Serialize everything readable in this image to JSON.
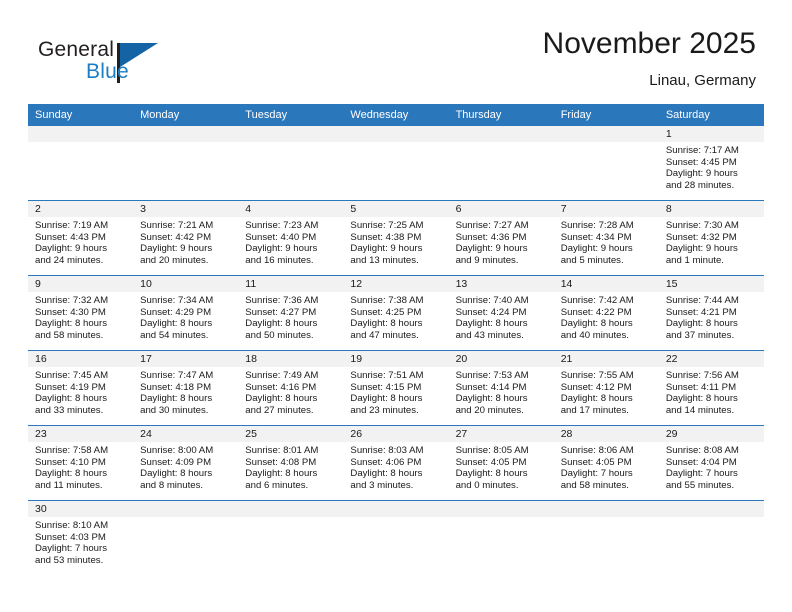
{
  "brand": {
    "name_top": "General",
    "name_bottom": "Blue",
    "accent_color": "#1464a5",
    "blue_text_color": "#1d7dc4"
  },
  "header": {
    "title": "November 2025",
    "subtitle": "Linau, Germany"
  },
  "theme": {
    "header_band": "#2b77bc",
    "daynum_strip": "#f2f2f2",
    "grid_line": "#2b77bc",
    "text": "#1a1a1a"
  },
  "calendar": {
    "weekday_headers": [
      "Sunday",
      "Monday",
      "Tuesday",
      "Wednesday",
      "Thursday",
      "Friday",
      "Saturday"
    ],
    "weeks": [
      [
        {
          "day": "",
          "sunrise": "",
          "sunset": "",
          "daylight": "",
          "daylight2": ""
        },
        {
          "day": "",
          "sunrise": "",
          "sunset": "",
          "daylight": "",
          "daylight2": ""
        },
        {
          "day": "",
          "sunrise": "",
          "sunset": "",
          "daylight": "",
          "daylight2": ""
        },
        {
          "day": "",
          "sunrise": "",
          "sunset": "",
          "daylight": "",
          "daylight2": ""
        },
        {
          "day": "",
          "sunrise": "",
          "sunset": "",
          "daylight": "",
          "daylight2": ""
        },
        {
          "day": "",
          "sunrise": "",
          "sunset": "",
          "daylight": "",
          "daylight2": ""
        },
        {
          "day": "1",
          "sunrise": "Sunrise: 7:17 AM",
          "sunset": "Sunset: 4:45 PM",
          "daylight": "Daylight: 9 hours",
          "daylight2": "and 28 minutes."
        }
      ],
      [
        {
          "day": "2",
          "sunrise": "Sunrise: 7:19 AM",
          "sunset": "Sunset: 4:43 PM",
          "daylight": "Daylight: 9 hours",
          "daylight2": "and 24 minutes."
        },
        {
          "day": "3",
          "sunrise": "Sunrise: 7:21 AM",
          "sunset": "Sunset: 4:42 PM",
          "daylight": "Daylight: 9 hours",
          "daylight2": "and 20 minutes."
        },
        {
          "day": "4",
          "sunrise": "Sunrise: 7:23 AM",
          "sunset": "Sunset: 4:40 PM",
          "daylight": "Daylight: 9 hours",
          "daylight2": "and 16 minutes."
        },
        {
          "day": "5",
          "sunrise": "Sunrise: 7:25 AM",
          "sunset": "Sunset: 4:38 PM",
          "daylight": "Daylight: 9 hours",
          "daylight2": "and 13 minutes."
        },
        {
          "day": "6",
          "sunrise": "Sunrise: 7:27 AM",
          "sunset": "Sunset: 4:36 PM",
          "daylight": "Daylight: 9 hours",
          "daylight2": "and 9 minutes."
        },
        {
          "day": "7",
          "sunrise": "Sunrise: 7:28 AM",
          "sunset": "Sunset: 4:34 PM",
          "daylight": "Daylight: 9 hours",
          "daylight2": "and 5 minutes."
        },
        {
          "day": "8",
          "sunrise": "Sunrise: 7:30 AM",
          "sunset": "Sunset: 4:32 PM",
          "daylight": "Daylight: 9 hours",
          "daylight2": "and 1 minute."
        }
      ],
      [
        {
          "day": "9",
          "sunrise": "Sunrise: 7:32 AM",
          "sunset": "Sunset: 4:30 PM",
          "daylight": "Daylight: 8 hours",
          "daylight2": "and 58 minutes."
        },
        {
          "day": "10",
          "sunrise": "Sunrise: 7:34 AM",
          "sunset": "Sunset: 4:29 PM",
          "daylight": "Daylight: 8 hours",
          "daylight2": "and 54 minutes."
        },
        {
          "day": "11",
          "sunrise": "Sunrise: 7:36 AM",
          "sunset": "Sunset: 4:27 PM",
          "daylight": "Daylight: 8 hours",
          "daylight2": "and 50 minutes."
        },
        {
          "day": "12",
          "sunrise": "Sunrise: 7:38 AM",
          "sunset": "Sunset: 4:25 PM",
          "daylight": "Daylight: 8 hours",
          "daylight2": "and 47 minutes."
        },
        {
          "day": "13",
          "sunrise": "Sunrise: 7:40 AM",
          "sunset": "Sunset: 4:24 PM",
          "daylight": "Daylight: 8 hours",
          "daylight2": "and 43 minutes."
        },
        {
          "day": "14",
          "sunrise": "Sunrise: 7:42 AM",
          "sunset": "Sunset: 4:22 PM",
          "daylight": "Daylight: 8 hours",
          "daylight2": "and 40 minutes."
        },
        {
          "day": "15",
          "sunrise": "Sunrise: 7:44 AM",
          "sunset": "Sunset: 4:21 PM",
          "daylight": "Daylight: 8 hours",
          "daylight2": "and 37 minutes."
        }
      ],
      [
        {
          "day": "16",
          "sunrise": "Sunrise: 7:45 AM",
          "sunset": "Sunset: 4:19 PM",
          "daylight": "Daylight: 8 hours",
          "daylight2": "and 33 minutes."
        },
        {
          "day": "17",
          "sunrise": "Sunrise: 7:47 AM",
          "sunset": "Sunset: 4:18 PM",
          "daylight": "Daylight: 8 hours",
          "daylight2": "and 30 minutes."
        },
        {
          "day": "18",
          "sunrise": "Sunrise: 7:49 AM",
          "sunset": "Sunset: 4:16 PM",
          "daylight": "Daylight: 8 hours",
          "daylight2": "and 27 minutes."
        },
        {
          "day": "19",
          "sunrise": "Sunrise: 7:51 AM",
          "sunset": "Sunset: 4:15 PM",
          "daylight": "Daylight: 8 hours",
          "daylight2": "and 23 minutes."
        },
        {
          "day": "20",
          "sunrise": "Sunrise: 7:53 AM",
          "sunset": "Sunset: 4:14 PM",
          "daylight": "Daylight: 8 hours",
          "daylight2": "and 20 minutes."
        },
        {
          "day": "21",
          "sunrise": "Sunrise: 7:55 AM",
          "sunset": "Sunset: 4:12 PM",
          "daylight": "Daylight: 8 hours",
          "daylight2": "and 17 minutes."
        },
        {
          "day": "22",
          "sunrise": "Sunrise: 7:56 AM",
          "sunset": "Sunset: 4:11 PM",
          "daylight": "Daylight: 8 hours",
          "daylight2": "and 14 minutes."
        }
      ],
      [
        {
          "day": "23",
          "sunrise": "Sunrise: 7:58 AM",
          "sunset": "Sunset: 4:10 PM",
          "daylight": "Daylight: 8 hours",
          "daylight2": "and 11 minutes."
        },
        {
          "day": "24",
          "sunrise": "Sunrise: 8:00 AM",
          "sunset": "Sunset: 4:09 PM",
          "daylight": "Daylight: 8 hours",
          "daylight2": "and 8 minutes."
        },
        {
          "day": "25",
          "sunrise": "Sunrise: 8:01 AM",
          "sunset": "Sunset: 4:08 PM",
          "daylight": "Daylight: 8 hours",
          "daylight2": "and 6 minutes."
        },
        {
          "day": "26",
          "sunrise": "Sunrise: 8:03 AM",
          "sunset": "Sunset: 4:06 PM",
          "daylight": "Daylight: 8 hours",
          "daylight2": "and 3 minutes."
        },
        {
          "day": "27",
          "sunrise": "Sunrise: 8:05 AM",
          "sunset": "Sunset: 4:05 PM",
          "daylight": "Daylight: 8 hours",
          "daylight2": "and 0 minutes."
        },
        {
          "day": "28",
          "sunrise": "Sunrise: 8:06 AM",
          "sunset": "Sunset: 4:05 PM",
          "daylight": "Daylight: 7 hours",
          "daylight2": "and 58 minutes."
        },
        {
          "day": "29",
          "sunrise": "Sunrise: 8:08 AM",
          "sunset": "Sunset: 4:04 PM",
          "daylight": "Daylight: 7 hours",
          "daylight2": "and 55 minutes."
        }
      ],
      [
        {
          "day": "30",
          "sunrise": "Sunrise: 8:10 AM",
          "sunset": "Sunset: 4:03 PM",
          "daylight": "Daylight: 7 hours",
          "daylight2": "and 53 minutes."
        },
        {
          "day": "",
          "sunrise": "",
          "sunset": "",
          "daylight": "",
          "daylight2": ""
        },
        {
          "day": "",
          "sunrise": "",
          "sunset": "",
          "daylight": "",
          "daylight2": ""
        },
        {
          "day": "",
          "sunrise": "",
          "sunset": "",
          "daylight": "",
          "daylight2": ""
        },
        {
          "day": "",
          "sunrise": "",
          "sunset": "",
          "daylight": "",
          "daylight2": ""
        },
        {
          "day": "",
          "sunrise": "",
          "sunset": "",
          "daylight": "",
          "daylight2": ""
        },
        {
          "day": "",
          "sunrise": "",
          "sunset": "",
          "daylight": "",
          "daylight2": ""
        }
      ]
    ]
  }
}
